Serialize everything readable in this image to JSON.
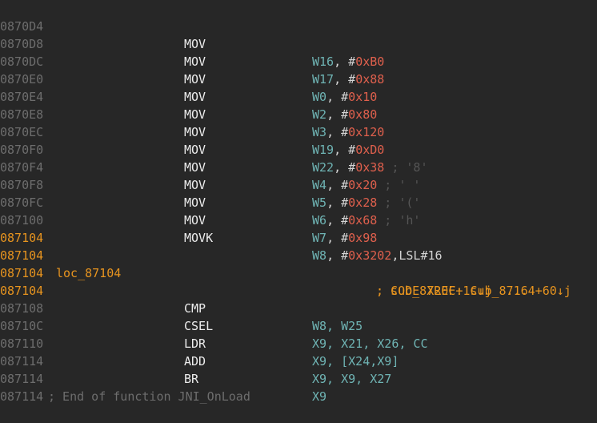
{
  "instructions": [
    {
      "addr": "0870D4",
      "mnem": "MOV",
      "reg": "W16",
      "imm": "0xB0",
      "cmt": ""
    },
    {
      "addr": "0870D8",
      "mnem": "MOV",
      "reg": "W17",
      "imm": "0x88",
      "cmt": ""
    },
    {
      "addr": "0870DC",
      "mnem": "MOV",
      "reg": "W0",
      "imm": "0x10",
      "cmt": ""
    },
    {
      "addr": "0870E0",
      "mnem": "MOV",
      "reg": "W2",
      "imm": "0x80",
      "cmt": ""
    },
    {
      "addr": "0870E4",
      "mnem": "MOV",
      "reg": "W3",
      "imm": "0x120",
      "cmt": ""
    },
    {
      "addr": "0870E8",
      "mnem": "MOV",
      "reg": "W19",
      "imm": "0xD0",
      "cmt": ""
    },
    {
      "addr": "0870EC",
      "mnem": "MOV",
      "reg": "W22",
      "imm": "0x38",
      "cmt": " ; '8'"
    },
    {
      "addr": "0870F0",
      "mnem": "MOV",
      "reg": "W4",
      "imm": "0x20",
      "cmt": " ; ' '"
    },
    {
      "addr": "0870F4",
      "mnem": "MOV",
      "reg": "W5",
      "imm": "0x28",
      "cmt": " ; '('"
    },
    {
      "addr": "0870F8",
      "mnem": "MOV",
      "reg": "W6",
      "imm": "0x68",
      "cmt": " ; 'h'"
    },
    {
      "addr": "0870FC",
      "mnem": "MOV",
      "reg": "W7",
      "imm": "0x98",
      "cmt": ""
    },
    {
      "addr": "087100",
      "mnem": "MOVK",
      "reg": "W8",
      "imm": "0x3202",
      "suffix": ",LSL#16",
      "cmt": ""
    }
  ],
  "blank_addr": "087104",
  "label_row": {
    "addr": "087104",
    "label": "loc_87104",
    "xref": "; CODE XREF: sub_87164+60↓j"
  },
  "xref_row": {
    "addr": "087104",
    "xref": "; sub_8720C+1C↓j  ..."
  },
  "block": [
    {
      "addr": "087104",
      "mnem": "CMP",
      "ops": "W8, W25"
    },
    {
      "addr": "087108",
      "mnem": "CSEL",
      "ops": "X9, X21, X26, CC"
    },
    {
      "addr": "08710C",
      "mnem": "LDR",
      "ops": "X9, [X24,X9]"
    },
    {
      "addr": "087110",
      "mnem": "ADD",
      "ops": "X9, X9, X27"
    },
    {
      "addr": "087114",
      "mnem": "BR",
      "ops": "X9"
    }
  ],
  "end_row": {
    "addr": "087114",
    "comment": "; End of function JNI_OnLoad"
  },
  "cut_addr": "087114",
  "colors": {
    "background": "#272727",
    "address": "#6d6d6d",
    "highlight_address": "#e7941f",
    "mnemonic": "#ececec",
    "register": "#6fb4b4",
    "immediate": "#e0604d",
    "comment": "#555555"
  }
}
